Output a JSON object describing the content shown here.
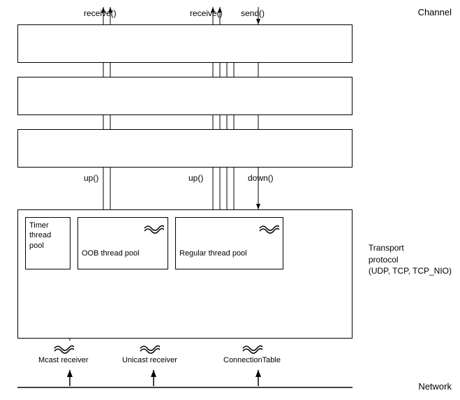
{
  "diagram": {
    "channel_label": "Channel",
    "transport_label": "Transport\nprotocol\n(UDP, TCP, TCP_NIO)",
    "network_label": "Network",
    "functions": {
      "receive1": "receive()",
      "receive2": "receive()",
      "send1": "send()",
      "up1": "up()",
      "up2": "up()",
      "down1": "down()"
    },
    "inner_boxes": {
      "timer": "Timer\nthread\npool",
      "oob": "OOB thread pool",
      "regular": "Regular thread pool"
    },
    "below_labels": {
      "mcast": "Mcast receiver",
      "unicast": "Unicast receiver",
      "connection": "ConnectionTable"
    }
  }
}
